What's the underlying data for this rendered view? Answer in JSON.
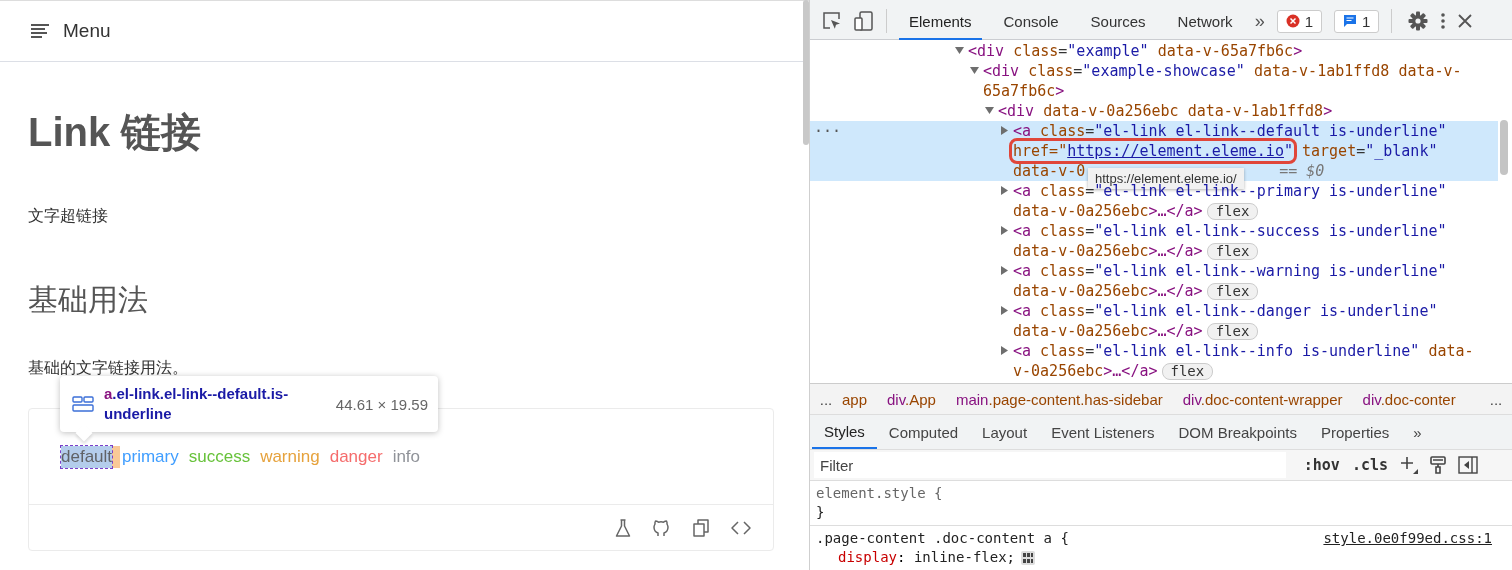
{
  "page": {
    "menu_label": "Menu",
    "title": "Link 链接",
    "intro": "文字超链接",
    "section_title": "基础用法",
    "section_desc": "基础的文字链接用法。",
    "demo_links": [
      {
        "label": "default",
        "color": "#606266",
        "inspected": true
      },
      {
        "label": "primary",
        "color": "#409eff",
        "inspected": false
      },
      {
        "label": "success",
        "color": "#67c23a",
        "inspected": false
      },
      {
        "label": "warning",
        "color": "#e6a23c",
        "inspected": false
      },
      {
        "label": "danger",
        "color": "#f56c6c",
        "inspected": false
      },
      {
        "label": "info",
        "color": "#909399",
        "inspected": false
      }
    ]
  },
  "inspect_tooltip": {
    "tag": "a",
    "classes": ".el-link.el-link--default.is-underline",
    "size": "44.61 × 19.59"
  },
  "devtools": {
    "tabs": [
      {
        "label": "Elements",
        "selected": true
      },
      {
        "label": "Console",
        "selected": false
      },
      {
        "label": "Sources",
        "selected": false
      },
      {
        "label": "Network",
        "selected": false
      }
    ],
    "more_tabs": "»",
    "error_count": "1",
    "message_count": "1",
    "dom_tree": [
      {
        "expanded": true,
        "selected": false,
        "lines": [
          [
            {
              "text": "<div",
              "kind": "tag"
            },
            {
              "text": "class",
              "kind": "attr"
            },
            {
              "text": "=",
              "kind": "punct"
            },
            {
              "text": "\"example\"",
              "kind": "value"
            },
            {
              "text": "data-v-65a7fb6c",
              "kind": "attr"
            },
            {
              "text": ">",
              "kind": "tag"
            }
          ]
        ],
        "children": [
          {
            "expanded": true,
            "selected": false,
            "lines": [
              [
                {
                  "text": "<div",
                  "kind": "tag"
                },
                {
                  "text": "class",
                  "kind": "attr"
                },
                {
                  "text": "=",
                  "kind": "punct"
                },
                {
                  "text": "\"example-showcase\"",
                  "kind": "value"
                },
                {
                  "text": "data-v-1ab1ffd8",
                  "kind": "attr"
                },
                {
                  "text": "data-v-",
                  "kind": "attr"
                }
              ],
              [
                {
                  "text": "65a7fb6c",
                  "kind": "attr"
                },
                {
                  "text": ">",
                  "kind": "tag"
                }
              ]
            ],
            "children": [
              {
                "expanded": true,
                "selected": false,
                "lines": [
                  [
                    {
                      "text": "<div",
                      "kind": "tag"
                    },
                    {
                      "text": "data-v-0a256ebc",
                      "kind": "attr"
                    },
                    {
                      "text": "data-v-1ab1ffd8",
                      "kind": "attr"
                    },
                    {
                      "text": ">",
                      "kind": "tag"
                    }
                  ]
                ],
                "children": [
                  {
                    "expanded": false,
                    "selected": true,
                    "gutter": "···",
                    "url_tooltip": "https://element.eleme.io/",
                    "marker": "== $0",
                    "lines": [
                      [
                        {
                          "text": "<a",
                          "kind": "tag"
                        },
                        {
                          "text": "class",
                          "kind": "attr"
                        },
                        {
                          "text": "=",
                          "kind": "punct"
                        },
                        {
                          "text": "\"el-link el-link--default is-underline\"",
                          "kind": "value"
                        }
                      ],
                      [
                        {
                          "text": "href=\"",
                          "kind": "attr",
                          "annotated": true
                        },
                        {
                          "text": "https://element.eleme.io",
                          "kind": "link",
                          "annotated": true
                        },
                        {
                          "text": "\"",
                          "kind": "value",
                          "annotated": true
                        },
                        {
                          "text": "target",
                          "kind": "attr"
                        },
                        {
                          "text": "=",
                          "kind": "punct"
                        },
                        {
                          "text": "\"_blank\"",
                          "kind": "value"
                        }
                      ],
                      [
                        {
                          "text": "data-v-0",
                          "kind": "attr"
                        }
                      ]
                    ]
                  },
                  {
                    "expanded": false,
                    "selected": false,
                    "badge": "flex",
                    "lines": [
                      [
                        {
                          "text": "<a",
                          "kind": "tag"
                        },
                        {
                          "text": "class",
                          "kind": "attr"
                        },
                        {
                          "text": "=",
                          "kind": "punct"
                        },
                        {
                          "text": "\"el-link el-link--primary is-underline\"",
                          "kind": "value"
                        }
                      ],
                      [
                        {
                          "text": "data-v-0a256ebc",
                          "kind": "attr"
                        },
                        {
                          "text": ">…</a>",
                          "kind": "tag"
                        }
                      ]
                    ]
                  },
                  {
                    "expanded": false,
                    "selected": false,
                    "badge": "flex",
                    "lines": [
                      [
                        {
                          "text": "<a",
                          "kind": "tag"
                        },
                        {
                          "text": "class",
                          "kind": "attr"
                        },
                        {
                          "text": "=",
                          "kind": "punct"
                        },
                        {
                          "text": "\"el-link el-link--success is-underline\"",
                          "kind": "value"
                        }
                      ],
                      [
                        {
                          "text": "data-v-0a256ebc",
                          "kind": "attr"
                        },
                        {
                          "text": ">…</a>",
                          "kind": "tag"
                        }
                      ]
                    ]
                  },
                  {
                    "expanded": false,
                    "selected": false,
                    "badge": "flex",
                    "lines": [
                      [
                        {
                          "text": "<a",
                          "kind": "tag"
                        },
                        {
                          "text": "class",
                          "kind": "attr"
                        },
                        {
                          "text": "=",
                          "kind": "punct"
                        },
                        {
                          "text": "\"el-link el-link--warning is-underline\"",
                          "kind": "value"
                        }
                      ],
                      [
                        {
                          "text": "data-v-0a256ebc",
                          "kind": "attr"
                        },
                        {
                          "text": ">…</a>",
                          "kind": "tag"
                        }
                      ]
                    ]
                  },
                  {
                    "expanded": false,
                    "selected": false,
                    "badge": "flex",
                    "lines": [
                      [
                        {
                          "text": "<a",
                          "kind": "tag"
                        },
                        {
                          "text": "class",
                          "kind": "attr"
                        },
                        {
                          "text": "=",
                          "kind": "punct"
                        },
                        {
                          "text": "\"el-link el-link--danger is-underline\"",
                          "kind": "value"
                        }
                      ],
                      [
                        {
                          "text": "data-v-0a256ebc",
                          "kind": "attr"
                        },
                        {
                          "text": ">…</a>",
                          "kind": "tag"
                        }
                      ]
                    ]
                  },
                  {
                    "expanded": false,
                    "selected": false,
                    "badge": "flex",
                    "lines": [
                      [
                        {
                          "text": "<a",
                          "kind": "tag"
                        },
                        {
                          "text": "class",
                          "kind": "attr"
                        },
                        {
                          "text": "=",
                          "kind": "punct"
                        },
                        {
                          "text": "\"el-link el-link--info is-underline\"",
                          "kind": "value"
                        },
                        {
                          "text": "data-",
                          "kind": "attr"
                        }
                      ],
                      [
                        {
                          "text": "v-0a256ebc",
                          "kind": "attr"
                        },
                        {
                          "text": ">…</a>",
                          "kind": "tag"
                        }
                      ]
                    ]
                  }
                ]
              }
            ]
          }
        ]
      }
    ],
    "breadcrumbs": [
      {
        "classes": "app"
      },
      {
        "tag": "div",
        "classes": ".App"
      },
      {
        "tag": "main",
        "classes": ".page-content.has-sidebar"
      },
      {
        "tag": "div",
        "classes": ".doc-content-wrapper"
      },
      {
        "tag": "div",
        "classes": ".doc-conter"
      }
    ],
    "breadcrumb_overflow": "...",
    "panel_tabs": [
      {
        "label": "Styles",
        "selected": true
      },
      {
        "label": "Computed",
        "selected": false
      },
      {
        "label": "Layout",
        "selected": false
      },
      {
        "label": "Event Listeners",
        "selected": false
      },
      {
        "label": "DOM Breakpoints",
        "selected": false
      },
      {
        "label": "Properties",
        "selected": false
      }
    ],
    "filter": {
      "placeholder": "Filter"
    },
    "filter_toggles": [
      ":hov",
      ".cls"
    ],
    "rules": [
      {
        "selector": "element.style",
        "inline": true,
        "open": "{",
        "close": "}"
      },
      {
        "selector": ".page-content .doc-content a",
        "inline": false,
        "open": "{",
        "source": "style.0e0f99ed.css:1",
        "declarations": [
          {
            "property": "display",
            "separator": ":",
            "value": "inline-flex;"
          }
        ]
      }
    ]
  }
}
